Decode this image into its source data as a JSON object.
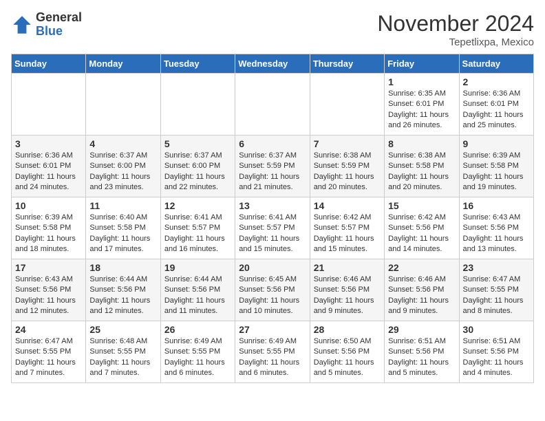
{
  "header": {
    "logo_general": "General",
    "logo_blue": "Blue",
    "month_title": "November 2024",
    "location": "Tepetlixpa, Mexico"
  },
  "days_of_week": [
    "Sunday",
    "Monday",
    "Tuesday",
    "Wednesday",
    "Thursday",
    "Friday",
    "Saturday"
  ],
  "weeks": [
    [
      {
        "day": "",
        "info": ""
      },
      {
        "day": "",
        "info": ""
      },
      {
        "day": "",
        "info": ""
      },
      {
        "day": "",
        "info": ""
      },
      {
        "day": "",
        "info": ""
      },
      {
        "day": "1",
        "info": "Sunrise: 6:35 AM\nSunset: 6:01 PM\nDaylight: 11 hours and 26 minutes."
      },
      {
        "day": "2",
        "info": "Sunrise: 6:36 AM\nSunset: 6:01 PM\nDaylight: 11 hours and 25 minutes."
      }
    ],
    [
      {
        "day": "3",
        "info": "Sunrise: 6:36 AM\nSunset: 6:01 PM\nDaylight: 11 hours and 24 minutes."
      },
      {
        "day": "4",
        "info": "Sunrise: 6:37 AM\nSunset: 6:00 PM\nDaylight: 11 hours and 23 minutes."
      },
      {
        "day": "5",
        "info": "Sunrise: 6:37 AM\nSunset: 6:00 PM\nDaylight: 11 hours and 22 minutes."
      },
      {
        "day": "6",
        "info": "Sunrise: 6:37 AM\nSunset: 5:59 PM\nDaylight: 11 hours and 21 minutes."
      },
      {
        "day": "7",
        "info": "Sunrise: 6:38 AM\nSunset: 5:59 PM\nDaylight: 11 hours and 20 minutes."
      },
      {
        "day": "8",
        "info": "Sunrise: 6:38 AM\nSunset: 5:58 PM\nDaylight: 11 hours and 20 minutes."
      },
      {
        "day": "9",
        "info": "Sunrise: 6:39 AM\nSunset: 5:58 PM\nDaylight: 11 hours and 19 minutes."
      }
    ],
    [
      {
        "day": "10",
        "info": "Sunrise: 6:39 AM\nSunset: 5:58 PM\nDaylight: 11 hours and 18 minutes."
      },
      {
        "day": "11",
        "info": "Sunrise: 6:40 AM\nSunset: 5:58 PM\nDaylight: 11 hours and 17 minutes."
      },
      {
        "day": "12",
        "info": "Sunrise: 6:41 AM\nSunset: 5:57 PM\nDaylight: 11 hours and 16 minutes."
      },
      {
        "day": "13",
        "info": "Sunrise: 6:41 AM\nSunset: 5:57 PM\nDaylight: 11 hours and 15 minutes."
      },
      {
        "day": "14",
        "info": "Sunrise: 6:42 AM\nSunset: 5:57 PM\nDaylight: 11 hours and 15 minutes."
      },
      {
        "day": "15",
        "info": "Sunrise: 6:42 AM\nSunset: 5:56 PM\nDaylight: 11 hours and 14 minutes."
      },
      {
        "day": "16",
        "info": "Sunrise: 6:43 AM\nSunset: 5:56 PM\nDaylight: 11 hours and 13 minutes."
      }
    ],
    [
      {
        "day": "17",
        "info": "Sunrise: 6:43 AM\nSunset: 5:56 PM\nDaylight: 11 hours and 12 minutes."
      },
      {
        "day": "18",
        "info": "Sunrise: 6:44 AM\nSunset: 5:56 PM\nDaylight: 11 hours and 12 minutes."
      },
      {
        "day": "19",
        "info": "Sunrise: 6:44 AM\nSunset: 5:56 PM\nDaylight: 11 hours and 11 minutes."
      },
      {
        "day": "20",
        "info": "Sunrise: 6:45 AM\nSunset: 5:56 PM\nDaylight: 11 hours and 10 minutes."
      },
      {
        "day": "21",
        "info": "Sunrise: 6:46 AM\nSunset: 5:56 PM\nDaylight: 11 hours and 9 minutes."
      },
      {
        "day": "22",
        "info": "Sunrise: 6:46 AM\nSunset: 5:56 PM\nDaylight: 11 hours and 9 minutes."
      },
      {
        "day": "23",
        "info": "Sunrise: 6:47 AM\nSunset: 5:55 PM\nDaylight: 11 hours and 8 minutes."
      }
    ],
    [
      {
        "day": "24",
        "info": "Sunrise: 6:47 AM\nSunset: 5:55 PM\nDaylight: 11 hours and 7 minutes."
      },
      {
        "day": "25",
        "info": "Sunrise: 6:48 AM\nSunset: 5:55 PM\nDaylight: 11 hours and 7 minutes."
      },
      {
        "day": "26",
        "info": "Sunrise: 6:49 AM\nSunset: 5:55 PM\nDaylight: 11 hours and 6 minutes."
      },
      {
        "day": "27",
        "info": "Sunrise: 6:49 AM\nSunset: 5:55 PM\nDaylight: 11 hours and 6 minutes."
      },
      {
        "day": "28",
        "info": "Sunrise: 6:50 AM\nSunset: 5:56 PM\nDaylight: 11 hours and 5 minutes."
      },
      {
        "day": "29",
        "info": "Sunrise: 6:51 AM\nSunset: 5:56 PM\nDaylight: 11 hours and 5 minutes."
      },
      {
        "day": "30",
        "info": "Sunrise: 6:51 AM\nSunset: 5:56 PM\nDaylight: 11 hours and 4 minutes."
      }
    ]
  ]
}
